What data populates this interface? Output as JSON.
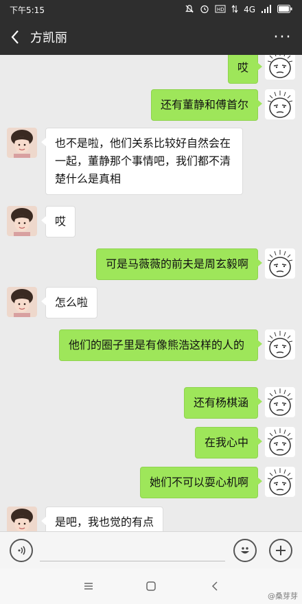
{
  "status_bar": {
    "time": "下午5:15",
    "network": "4G",
    "icons": [
      "mute-icon",
      "alarm-icon",
      "hd-icon",
      "data-arrows-icon",
      "signal-icon",
      "battery-icon"
    ]
  },
  "header": {
    "title": "方凯丽",
    "back_icon": "chevron-left-icon",
    "more_label": "···"
  },
  "messages": [
    {
      "side": "right",
      "text": "哎"
    },
    {
      "side": "right",
      "text": "还有董静和傅首尔"
    },
    {
      "side": "left",
      "text": "也不是啦，他们关系比较好自然会在一起，董静那个事情吧，我们都不清楚什么是真相"
    },
    {
      "side": "left",
      "text": "哎"
    },
    {
      "side": "right",
      "text": "可是马薇薇的前夫是周玄毅啊"
    },
    {
      "side": "left",
      "text": "怎么啦"
    },
    {
      "side": "right",
      "text": "他们的圈子里是有像熊浩这样的人的"
    },
    {
      "side": "right",
      "text": "还有杨棋涵"
    },
    {
      "side": "right",
      "text": "在我心中"
    },
    {
      "side": "right",
      "text": "她们不可以耍心机啊"
    },
    {
      "side": "left",
      "text": "是吧，我也觉的有点"
    }
  ],
  "input_bar": {
    "voice_icon": "voice-icon",
    "emoji_icon": "emoji-icon",
    "add_icon": "plus-icon"
  },
  "nav_bar": {
    "icons": [
      "menu-icon",
      "home-icon",
      "back-icon"
    ],
    "watermark": "@桑芽芽"
  },
  "colors": {
    "bar_dark": "#2e2e2e",
    "chat_bg": "#ebebeb",
    "sent_bubble": "#9ee65a",
    "received_bubble": "#ffffff"
  }
}
